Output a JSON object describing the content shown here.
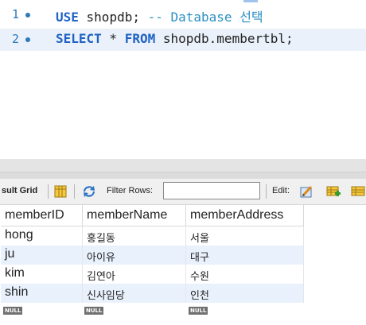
{
  "editor": {
    "lines": [
      {
        "number": "1",
        "keyword": "USE",
        "rest": " shopdb;",
        "comment": " -- Database 선택"
      },
      {
        "number": "2",
        "keyword": "SELECT",
        "mid1": " * ",
        "keyword2": "FROM",
        "rest": " shopdb.membertbl;"
      }
    ]
  },
  "toolbar": {
    "result_label": "sult Grid",
    "filter_label": "Filter Rows:",
    "filter_value": "",
    "edit_label": "Edit:"
  },
  "grid": {
    "columns": [
      "memberID",
      "memberName",
      "memberAddress"
    ],
    "rows": [
      [
        "hong",
        "홍길동",
        "서울"
      ],
      [
        "ju",
        "아이유",
        "대구"
      ],
      [
        "kim",
        "김연아",
        "수원"
      ],
      [
        "shin",
        "신사임당",
        "인천"
      ]
    ],
    "null_label": "NULL"
  },
  "colors": {
    "keyword": "#1f62c4",
    "comment": "#2b8fc2",
    "line_number": "#2b79b9",
    "active_line": "#eaf1fa",
    "alt_row": "#e9f1fc"
  }
}
